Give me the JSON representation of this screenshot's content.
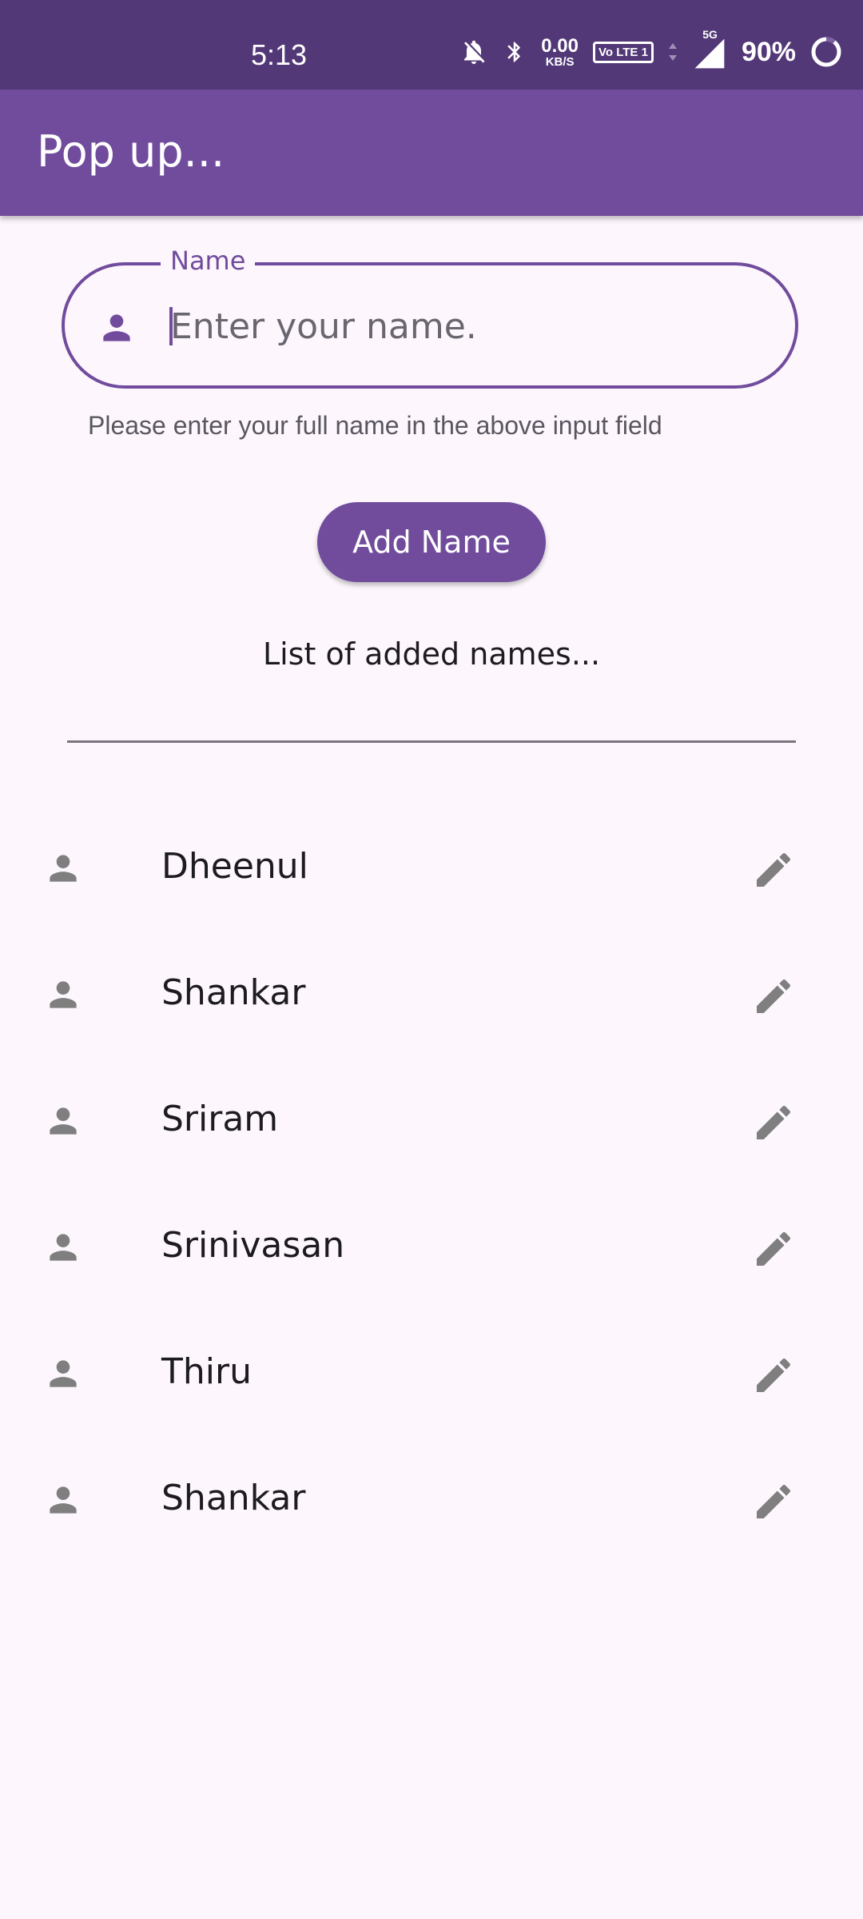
{
  "status_bar": {
    "time": "5:13",
    "net_speed_value": "0.00",
    "net_speed_unit": "KB/S",
    "volte_label": "Vo LTE 1",
    "network_type": "5G",
    "battery": "90%"
  },
  "app_bar": {
    "title": "Pop up..."
  },
  "name_field": {
    "label": "Name",
    "placeholder": "Enter your name.",
    "helper": "Please enter your full name in the above input field"
  },
  "add_button": {
    "label": "Add Name"
  },
  "list": {
    "heading": "List of added names...",
    "items": [
      {
        "name": "Dheenul"
      },
      {
        "name": "Shankar"
      },
      {
        "name": "Sriram"
      },
      {
        "name": "Srinivasan"
      },
      {
        "name": "Thiru"
      },
      {
        "name": "Shankar"
      }
    ]
  },
  "colors": {
    "primary": "#714c9d",
    "status_bar": "#533877",
    "background": "#fdf7fd",
    "icon_grey": "#7f7f7f"
  },
  "icons": {
    "field": "person-icon",
    "list_leading": "person-icon",
    "list_trailing": "pencil-icon"
  }
}
